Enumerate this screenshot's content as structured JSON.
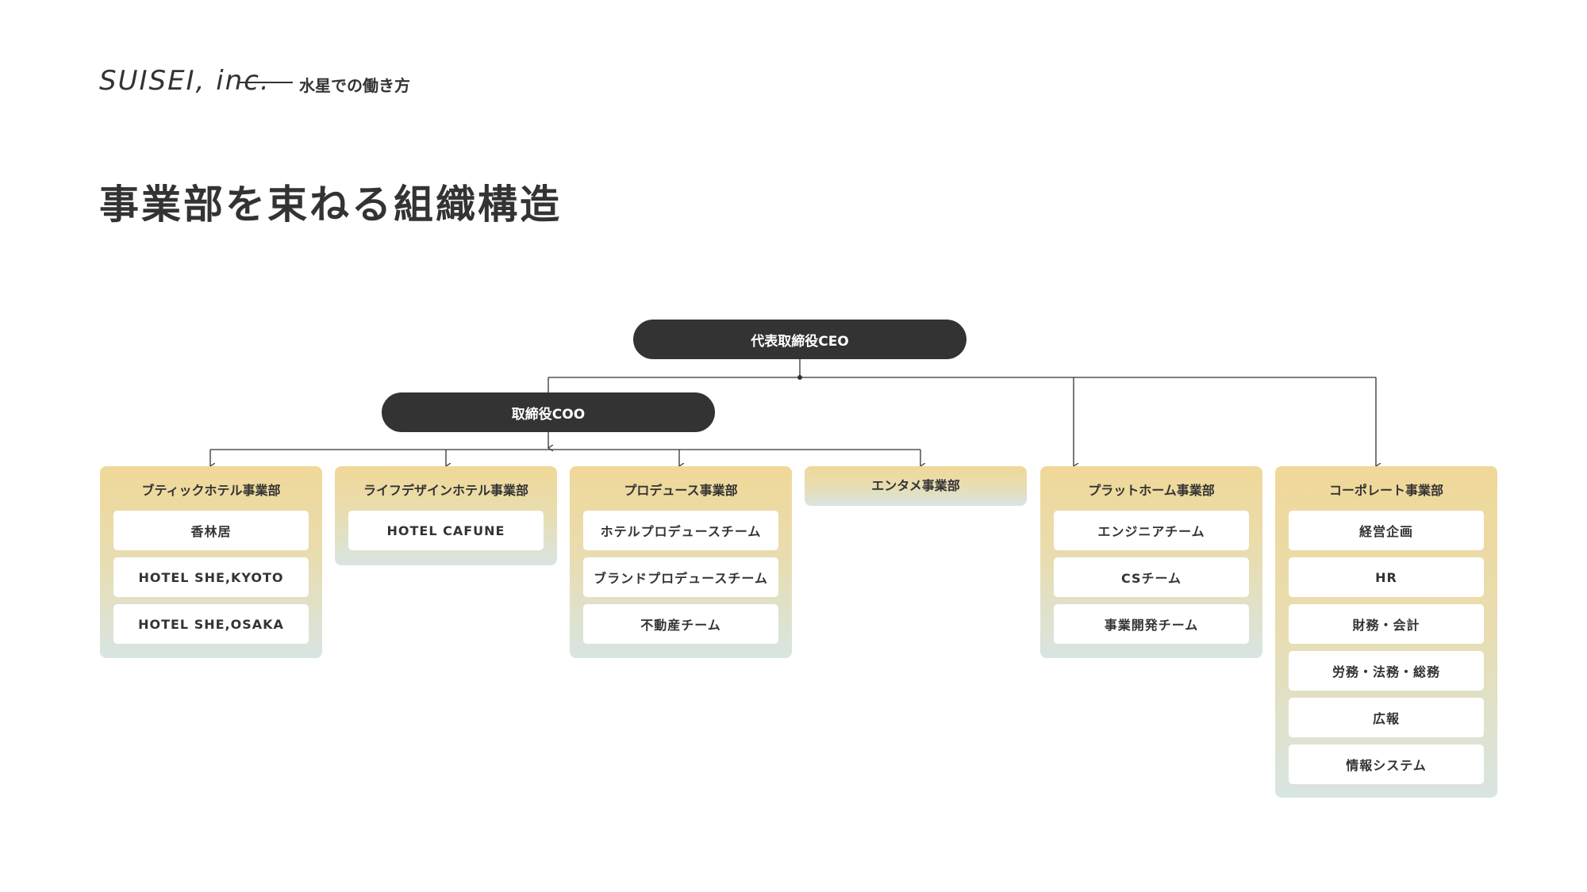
{
  "header": {
    "logo": "SUISEI, inc.",
    "tagline": "水星での働き方"
  },
  "page_title": "事業部を束ねる組織構造",
  "org": {
    "ceo": "代表取締役CEO",
    "coo": "取締役COO",
    "departments": [
      {
        "title": "ブティックホテル事業部",
        "items": [
          "香林居",
          "HOTEL SHE,KYOTO",
          "HOTEL SHE,OSAKA"
        ]
      },
      {
        "title": "ライフデザインホテル事業部",
        "items": [
          "HOTEL CAFUNE"
        ]
      },
      {
        "title": "プロデュース事業部",
        "items": [
          "ホテルプロデュースチーム",
          "ブランドプロデュースチーム",
          "不動産チーム"
        ]
      },
      {
        "title": "エンタメ事業部",
        "items": []
      },
      {
        "title": "プラットホーム事業部",
        "items": [
          "エンジニアチーム",
          "CSチーム",
          "事業開発チーム"
        ]
      },
      {
        "title": "コーポレート事業部",
        "items": [
          "経営企画",
          "HR",
          "財務・会計",
          "労務・法務・総務",
          "広報",
          "情報システム"
        ]
      }
    ]
  },
  "colors": {
    "pill_bg": "#333333",
    "card_gradient_top": "#f0d898",
    "card_gradient_bottom": "#d8e5e2",
    "text": "#333333"
  }
}
